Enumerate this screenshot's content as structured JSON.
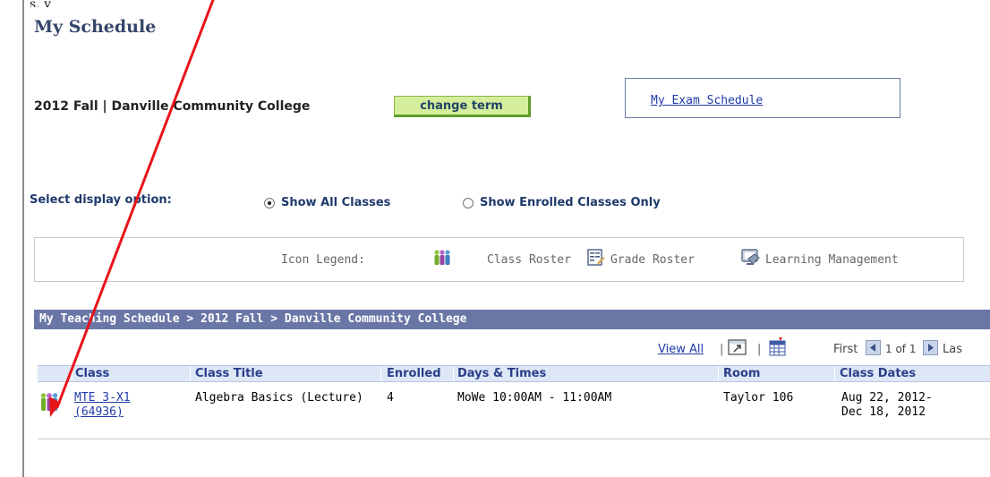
{
  "page": {
    "top_crop_text": "s,   y",
    "title": "My Schedule"
  },
  "term": {
    "label": "2012 Fall | Danville Community College",
    "change_button": "change term"
  },
  "exam": {
    "link": "My Exam Schedule"
  },
  "display_option": {
    "label": "Select display option:",
    "options": [
      {
        "label": "Show All Classes",
        "selected": true
      },
      {
        "label": "Show Enrolled Classes Only",
        "selected": false
      }
    ]
  },
  "legend": {
    "title": "Icon Legend:",
    "class_roster": "Class Roster",
    "grade_roster": "Grade Roster",
    "learning_management": "Learning Management",
    "icons": [
      "class-roster-icon",
      "grade-roster-icon",
      "learning-management-icon"
    ]
  },
  "schedule": {
    "header": "My Teaching Schedule > 2012 Fall > Danville Community College",
    "nav": {
      "view_all": "View All",
      "sep1": "|",
      "sep2": "|",
      "first": "First",
      "page": "1 of 1",
      "last": "Las"
    },
    "columns": [
      "Class",
      "Class Title",
      "Enrolled",
      "Days & Times",
      "Room",
      "Class Dates"
    ],
    "rows": [
      {
        "class_line1": "MTE 3-X1",
        "class_line2": "(64936)",
        "title": "Algebra Basics (Lecture)",
        "enrolled": "4",
        "days_times": "MoWe 10:00AM - 11:00AM",
        "room": "Taylor 106",
        "dates_line1": "Aug 22, 2012-",
        "dates_line2": "Dec 18, 2012"
      }
    ]
  },
  "colors": {
    "header_bar": "#6a77a6",
    "col_header_bg": "#dde7f5",
    "link": "#1f3aa8",
    "annotation_arrow": "#e8141b",
    "button_bg": "#d4ee9c"
  }
}
